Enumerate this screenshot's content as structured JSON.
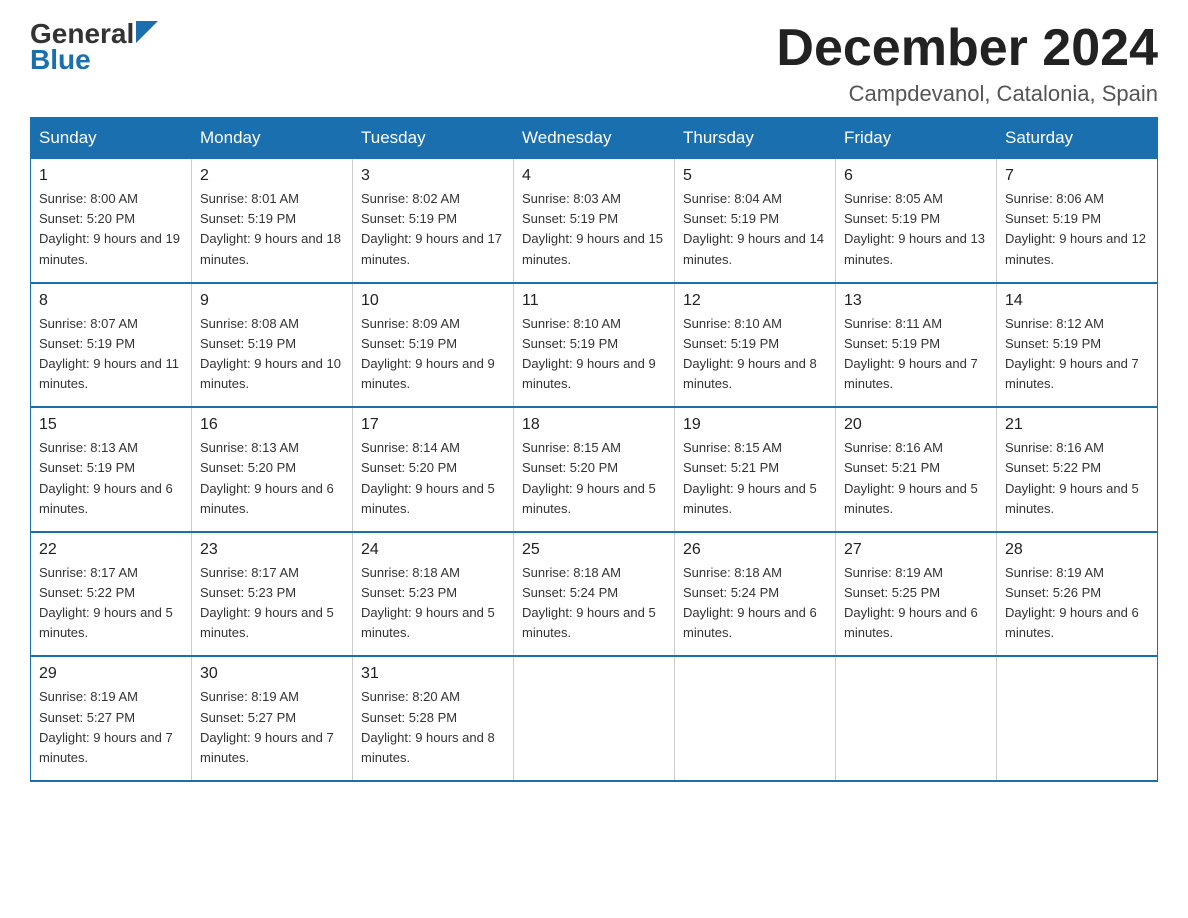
{
  "header": {
    "logo_line1": "General",
    "logo_line2": "Blue",
    "month_title": "December 2024",
    "location": "Campdevanol, Catalonia, Spain"
  },
  "weekdays": [
    "Sunday",
    "Monday",
    "Tuesday",
    "Wednesday",
    "Thursday",
    "Friday",
    "Saturday"
  ],
  "weeks": [
    [
      {
        "day": "1",
        "sunrise": "8:00 AM",
        "sunset": "5:20 PM",
        "daylight": "9 hours and 19 minutes."
      },
      {
        "day": "2",
        "sunrise": "8:01 AM",
        "sunset": "5:19 PM",
        "daylight": "9 hours and 18 minutes."
      },
      {
        "day": "3",
        "sunrise": "8:02 AM",
        "sunset": "5:19 PM",
        "daylight": "9 hours and 17 minutes."
      },
      {
        "day": "4",
        "sunrise": "8:03 AM",
        "sunset": "5:19 PM",
        "daylight": "9 hours and 15 minutes."
      },
      {
        "day": "5",
        "sunrise": "8:04 AM",
        "sunset": "5:19 PM",
        "daylight": "9 hours and 14 minutes."
      },
      {
        "day": "6",
        "sunrise": "8:05 AM",
        "sunset": "5:19 PM",
        "daylight": "9 hours and 13 minutes."
      },
      {
        "day": "7",
        "sunrise": "8:06 AM",
        "sunset": "5:19 PM",
        "daylight": "9 hours and 12 minutes."
      }
    ],
    [
      {
        "day": "8",
        "sunrise": "8:07 AM",
        "sunset": "5:19 PM",
        "daylight": "9 hours and 11 minutes."
      },
      {
        "day": "9",
        "sunrise": "8:08 AM",
        "sunset": "5:19 PM",
        "daylight": "9 hours and 10 minutes."
      },
      {
        "day": "10",
        "sunrise": "8:09 AM",
        "sunset": "5:19 PM",
        "daylight": "9 hours and 9 minutes."
      },
      {
        "day": "11",
        "sunrise": "8:10 AM",
        "sunset": "5:19 PM",
        "daylight": "9 hours and 9 minutes."
      },
      {
        "day": "12",
        "sunrise": "8:10 AM",
        "sunset": "5:19 PM",
        "daylight": "9 hours and 8 minutes."
      },
      {
        "day": "13",
        "sunrise": "8:11 AM",
        "sunset": "5:19 PM",
        "daylight": "9 hours and 7 minutes."
      },
      {
        "day": "14",
        "sunrise": "8:12 AM",
        "sunset": "5:19 PM",
        "daylight": "9 hours and 7 minutes."
      }
    ],
    [
      {
        "day": "15",
        "sunrise": "8:13 AM",
        "sunset": "5:19 PM",
        "daylight": "9 hours and 6 minutes."
      },
      {
        "day": "16",
        "sunrise": "8:13 AM",
        "sunset": "5:20 PM",
        "daylight": "9 hours and 6 minutes."
      },
      {
        "day": "17",
        "sunrise": "8:14 AM",
        "sunset": "5:20 PM",
        "daylight": "9 hours and 5 minutes."
      },
      {
        "day": "18",
        "sunrise": "8:15 AM",
        "sunset": "5:20 PM",
        "daylight": "9 hours and 5 minutes."
      },
      {
        "day": "19",
        "sunrise": "8:15 AM",
        "sunset": "5:21 PM",
        "daylight": "9 hours and 5 minutes."
      },
      {
        "day": "20",
        "sunrise": "8:16 AM",
        "sunset": "5:21 PM",
        "daylight": "9 hours and 5 minutes."
      },
      {
        "day": "21",
        "sunrise": "8:16 AM",
        "sunset": "5:22 PM",
        "daylight": "9 hours and 5 minutes."
      }
    ],
    [
      {
        "day": "22",
        "sunrise": "8:17 AM",
        "sunset": "5:22 PM",
        "daylight": "9 hours and 5 minutes."
      },
      {
        "day": "23",
        "sunrise": "8:17 AM",
        "sunset": "5:23 PM",
        "daylight": "9 hours and 5 minutes."
      },
      {
        "day": "24",
        "sunrise": "8:18 AM",
        "sunset": "5:23 PM",
        "daylight": "9 hours and 5 minutes."
      },
      {
        "day": "25",
        "sunrise": "8:18 AM",
        "sunset": "5:24 PM",
        "daylight": "9 hours and 5 minutes."
      },
      {
        "day": "26",
        "sunrise": "8:18 AM",
        "sunset": "5:24 PM",
        "daylight": "9 hours and 6 minutes."
      },
      {
        "day": "27",
        "sunrise": "8:19 AM",
        "sunset": "5:25 PM",
        "daylight": "9 hours and 6 minutes."
      },
      {
        "day": "28",
        "sunrise": "8:19 AM",
        "sunset": "5:26 PM",
        "daylight": "9 hours and 6 minutes."
      }
    ],
    [
      {
        "day": "29",
        "sunrise": "8:19 AM",
        "sunset": "5:27 PM",
        "daylight": "9 hours and 7 minutes."
      },
      {
        "day": "30",
        "sunrise": "8:19 AM",
        "sunset": "5:27 PM",
        "daylight": "9 hours and 7 minutes."
      },
      {
        "day": "31",
        "sunrise": "8:20 AM",
        "sunset": "5:28 PM",
        "daylight": "9 hours and 8 minutes."
      },
      null,
      null,
      null,
      null
    ]
  ]
}
